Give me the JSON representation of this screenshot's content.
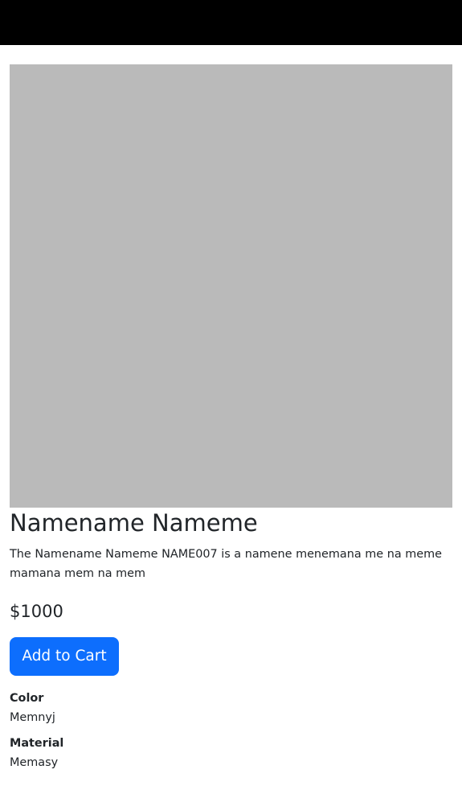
{
  "product": {
    "name": "Namename Nameme",
    "description": "The Namename Nameme NAME007 is a namene menemana me na meme mamana mem na mem",
    "price": "$1000",
    "add_to_cart_label": "Add to Cart",
    "specs": [
      {
        "label": "Color",
        "value": "Memnyj"
      },
      {
        "label": "Material",
        "value": "Memasy"
      }
    ]
  },
  "colors": {
    "top_bar": "#000000",
    "image_placeholder": "#bababa",
    "primary_button": "#0d6efd"
  }
}
